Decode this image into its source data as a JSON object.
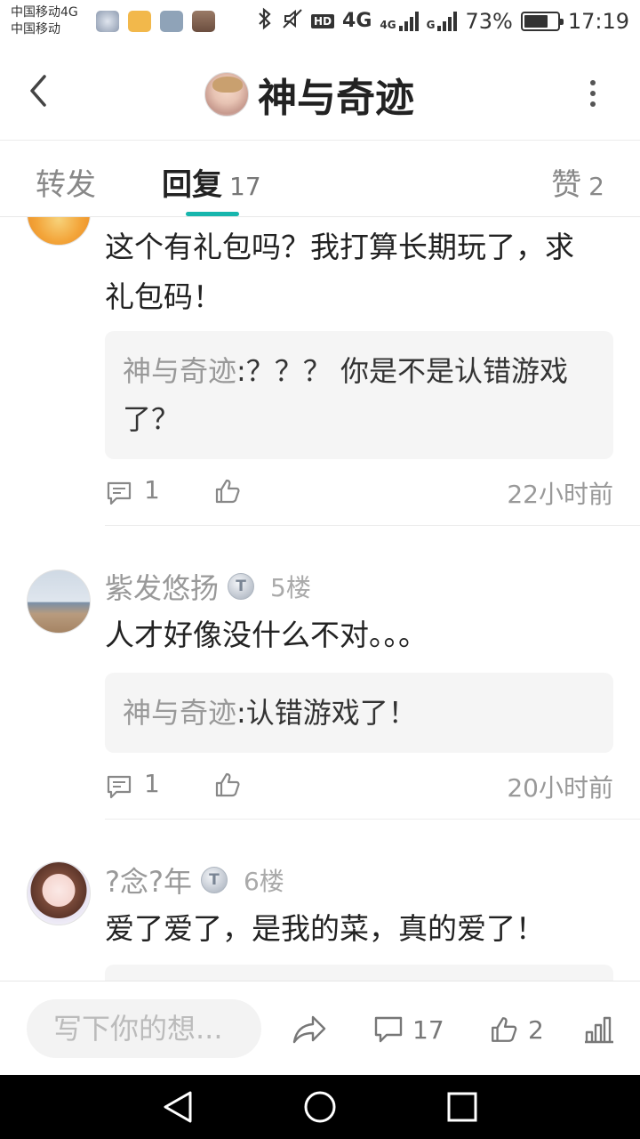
{
  "status_bar": {
    "carrier_1": "中国移动4G",
    "carrier_2": "中国移动",
    "hd": "HD",
    "net_1": "4G",
    "net_2": "4G",
    "net_3": "G",
    "battery": "73%",
    "battery_level": 0.73,
    "time": "17:19"
  },
  "header": {
    "title": "神与奇迹"
  },
  "tabs": {
    "repost_label": "转发",
    "reply_label": "回复",
    "reply_count": "17",
    "like_label": "赞",
    "like_count": "2"
  },
  "comments": [
    {
      "content": "这个有礼包吗？我打算长期玩了，求礼包码！",
      "quote_name": "神与奇迹",
      "quote_text": ":？？？ 你是不是认错游戏了？",
      "reply_count": "1",
      "time": "22小时前"
    },
    {
      "username": "紫发悠扬",
      "badge": "T",
      "floor": "5楼",
      "content": "人才好像没什么不对。。。",
      "quote_name": "神与奇迹",
      "quote_text": ":认错游戏了！",
      "reply_count": "1",
      "time": "20小时前"
    },
    {
      "username": "?念?年",
      "badge": "T",
      "floor": "6楼",
      "content": "爱了爱了，是我的菜，真的爱了！"
    }
  ],
  "bottom_bar": {
    "input_placeholder": "写下你的想...",
    "reply_count": "17",
    "like_count": "2"
  },
  "colors": {
    "accent": "#17b6ad"
  }
}
